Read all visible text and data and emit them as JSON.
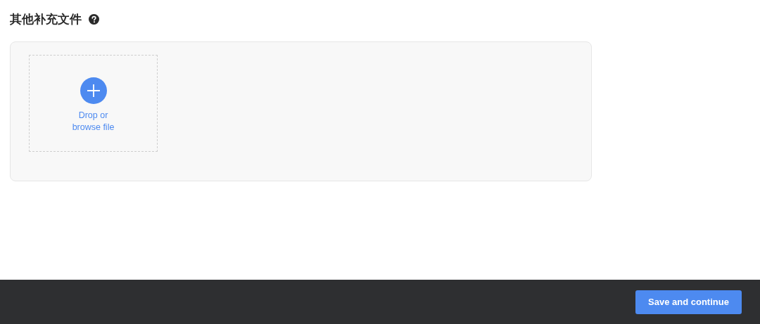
{
  "section": {
    "title": "其他补充文件"
  },
  "upload": {
    "label": "Drop or browse file"
  },
  "footer": {
    "button": "Save and continue"
  }
}
